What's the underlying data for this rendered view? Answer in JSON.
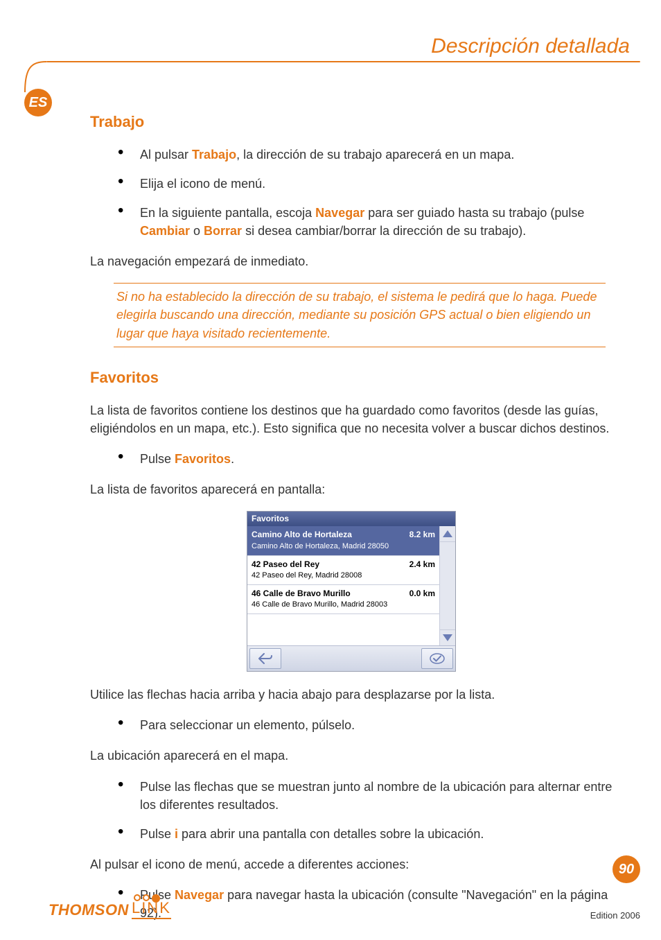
{
  "header": {
    "title": "Descripción detallada",
    "lang_badge": "ES"
  },
  "trabajo": {
    "heading": "Trabajo",
    "bullets": {
      "b1_pre": "Al pulsar ",
      "b1_bold": "Trabajo",
      "b1_post": ", la dirección de su trabajo aparecerá en un mapa.",
      "b2": "Elija el icono de menú.",
      "b3_pre": "En la siguiente pantalla, escoja ",
      "b3_bold1": "Navegar",
      "b3_mid": " para ser guiado hasta su trabajo (pulse ",
      "b3_bold2": "Cambiar",
      "b3_or": " o ",
      "b3_bold3": "Borrar",
      "b3_post": " si desea cambiar/borrar la dirección de su trabajo)."
    },
    "para_after": "La navegación empezará de inmediato.",
    "note": "Si no ha establecido la dirección de su trabajo, el sistema le pedirá que lo haga. Puede elegirla buscando una dirección, mediante su posición GPS actual o bien eligiendo un lugar que haya visitado recientemente."
  },
  "favoritos": {
    "heading": "Favoritos",
    "intro": "La lista de favoritos contiene los destinos que ha guardado como favoritos (desde las guías, eligiéndolos en un mapa, etc.). Esto significa que no necesita volver a buscar dichos destinos.",
    "bullet_pulse_pre": "Pulse ",
    "bullet_pulse_bold": "Favoritos",
    "bullet_pulse_post": ".",
    "list_caption": "La lista de favoritos aparecerá en pantalla:",
    "screenshot": {
      "title": "Favoritos",
      "items": [
        {
          "name": "Camino Alto de Hortaleza",
          "dist": "8.2 km",
          "addr": "Camino Alto de Hortaleza, Madrid 28050",
          "selected": true
        },
        {
          "name": "42 Paseo del Rey",
          "dist": "2.4 km",
          "addr": "42 Paseo del Rey, Madrid 28008",
          "selected": false
        },
        {
          "name": "46 Calle de Bravo Murillo",
          "dist": "0.0 km",
          "addr": "46 Calle de Bravo Murillo, Madrid 28003",
          "selected": false
        }
      ]
    },
    "para_arrows": "Utilice las flechas hacia arriba y hacia abajo para desplazarse por la lista.",
    "bullet_select": "Para seleccionar un elemento, púlselo.",
    "para_map": "La ubicación aparecerá en el mapa.",
    "bullet_alt_arrows": "Pulse las flechas que se muestran junto al nombre de la ubicación para alternar entre los diferentes resultados.",
    "bullet_i_pre": "Pulse ",
    "bullet_i_bold": "i",
    "bullet_i_post": " para abrir una pantalla con detalles sobre la ubicación.",
    "para_menu": "Al pulsar el icono de menú, accede a diferentes acciones:",
    "bullet_nav_pre": "Pulse ",
    "bullet_nav_bold": "Navegar",
    "bullet_nav_post": " para navegar hasta la ubicación (consulte \"Navegación\" en la página 92)."
  },
  "footer": {
    "page_number": "90",
    "edition": "Edition 2006",
    "brand_thomson": "THOMSON",
    "brand_link": "LINK"
  }
}
